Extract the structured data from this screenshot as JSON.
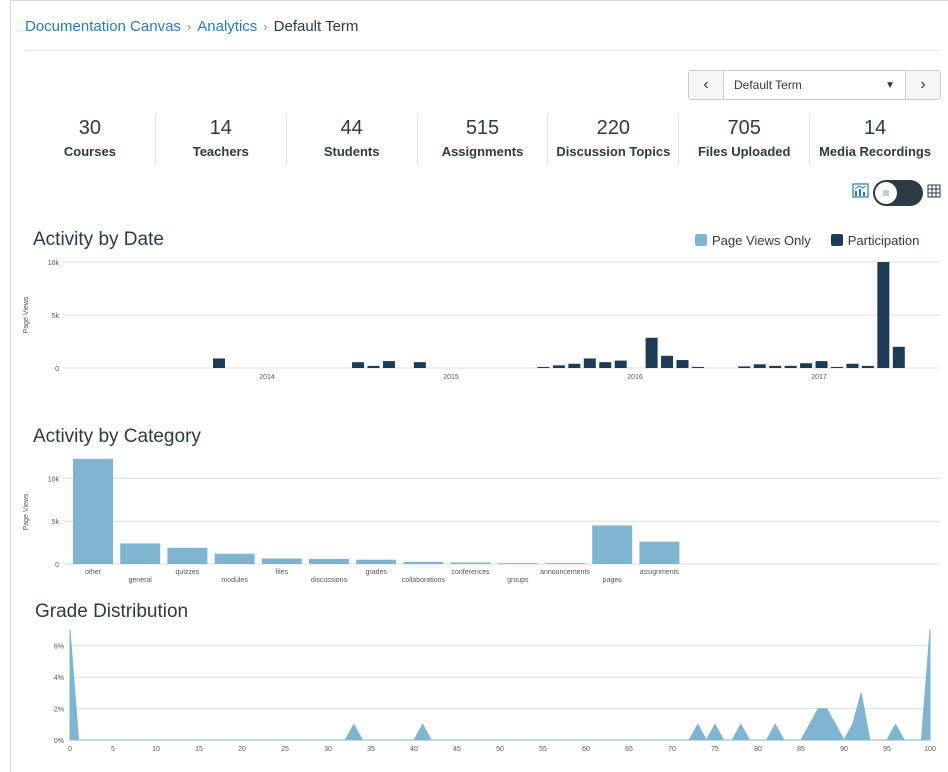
{
  "breadcrumb": {
    "items": [
      "Documentation Canvas",
      "Analytics"
    ],
    "current": "Default Term"
  },
  "term_selector": {
    "value": "Default Term",
    "prev_icon": "chevron-left-icon",
    "next_icon": "chevron-right-icon"
  },
  "stats": [
    {
      "value": "30",
      "label": "Courses"
    },
    {
      "value": "14",
      "label": "Teachers"
    },
    {
      "value": "44",
      "label": "Students"
    },
    {
      "value": "515",
      "label": "Assignments"
    },
    {
      "value": "220",
      "label": "Discussion Topics"
    },
    {
      "value": "705",
      "label": "Files Uploaded"
    },
    {
      "value": "14",
      "label": "Media Recordings"
    }
  ],
  "view_toggle": {
    "left_icon": "graph-icon",
    "right_icon": "table-icon",
    "state": "graph"
  },
  "colors": {
    "page_views": "#7fb5d0",
    "participation": "#1d3b56",
    "link": "#2a7ab8",
    "text": "#2d3b45"
  },
  "chart_data": [
    {
      "type": "bar",
      "title": "Activity by Date",
      "ylabel": "Page Views",
      "ylim": [
        0,
        10000
      ],
      "yticks": [
        {
          "v": 0,
          "label": "0"
        },
        {
          "v": 5000,
          "label": "5k"
        },
        {
          "v": 10000,
          "label": "10k"
        }
      ],
      "xticks": [
        "2014",
        "2015",
        "2016",
        "2017"
      ],
      "legend": {
        "placement": "top-right",
        "entries": [
          "Page Views Only",
          "Participation"
        ]
      },
      "bars": [
        {
          "i": 0,
          "v": 900
        },
        {
          "i": 9,
          "v": 550
        },
        {
          "i": 10,
          "v": 200
        },
        {
          "i": 11,
          "v": 650
        },
        {
          "i": 13,
          "v": 550
        },
        {
          "i": 21,
          "v": 100
        },
        {
          "i": 22,
          "v": 250
        },
        {
          "i": 23,
          "v": 400
        },
        {
          "i": 24,
          "v": 900
        },
        {
          "i": 25,
          "v": 550
        },
        {
          "i": 26,
          "v": 700
        },
        {
          "i": 28,
          "v": 2850
        },
        {
          "i": 29,
          "v": 1150
        },
        {
          "i": 30,
          "v": 750
        },
        {
          "i": 31,
          "v": 100
        },
        {
          "i": 34,
          "v": 150
        },
        {
          "i": 35,
          "v": 350
        },
        {
          "i": 36,
          "v": 200
        },
        {
          "i": 37,
          "v": 200
        },
        {
          "i": 38,
          "v": 450
        },
        {
          "i": 39,
          "v": 650
        },
        {
          "i": 40,
          "v": 100
        },
        {
          "i": 41,
          "v": 400
        },
        {
          "i": 42,
          "v": 200
        },
        {
          "i": 43,
          "v": 10000
        },
        {
          "i": 44,
          "v": 2000
        }
      ],
      "series": [
        {
          "name": "Participation"
        }
      ]
    },
    {
      "type": "bar",
      "title": "Activity by Category",
      "ylabel": "Page Views",
      "ylim": [
        0,
        12500
      ],
      "yticks": [
        {
          "v": 0,
          "label": "0"
        },
        {
          "v": 5000,
          "label": "5k"
        },
        {
          "v": 10000,
          "label": "10k"
        }
      ],
      "categories": [
        "other",
        "general",
        "quizzes",
        "modules",
        "files",
        "discussions",
        "grades",
        "collaborations",
        "conferences",
        "groups",
        "announcements",
        "pages",
        "assignments"
      ],
      "values": [
        12300,
        2400,
        1900,
        1200,
        650,
        600,
        500,
        250,
        180,
        100,
        100,
        4500,
        2600
      ]
    },
    {
      "type": "area",
      "title": "Grade Distribution",
      "ylim": [
        0,
        7
      ],
      "yticks": [
        {
          "v": 0,
          "label": "0%"
        },
        {
          "v": 2,
          "label": "2%"
        },
        {
          "v": 4,
          "label": "4%"
        },
        {
          "v": 6,
          "label": "6%"
        }
      ],
      "xlim": [
        0,
        100
      ],
      "xticks": [
        "0",
        "5",
        "10",
        "15",
        "20",
        "25",
        "30",
        "35",
        "40",
        "45",
        "50",
        "55",
        "60",
        "65",
        "70",
        "75",
        "80",
        "85",
        "90",
        "95",
        "100"
      ],
      "x": [
        0,
        1,
        32,
        33,
        34,
        40,
        41,
        42,
        72,
        73,
        74,
        75,
        76,
        77,
        78,
        79,
        81,
        82,
        83,
        85,
        87,
        88,
        90,
        91,
        92,
        93,
        95,
        96,
        97,
        99,
        100
      ],
      "y": [
        7,
        0,
        0,
        1,
        0,
        0,
        1,
        0,
        0,
        1,
        0,
        1,
        0,
        0,
        1,
        0,
        0,
        1,
        0,
        0,
        2,
        2,
        0,
        1,
        3,
        0,
        0,
        1,
        0,
        0,
        7
      ]
    }
  ]
}
